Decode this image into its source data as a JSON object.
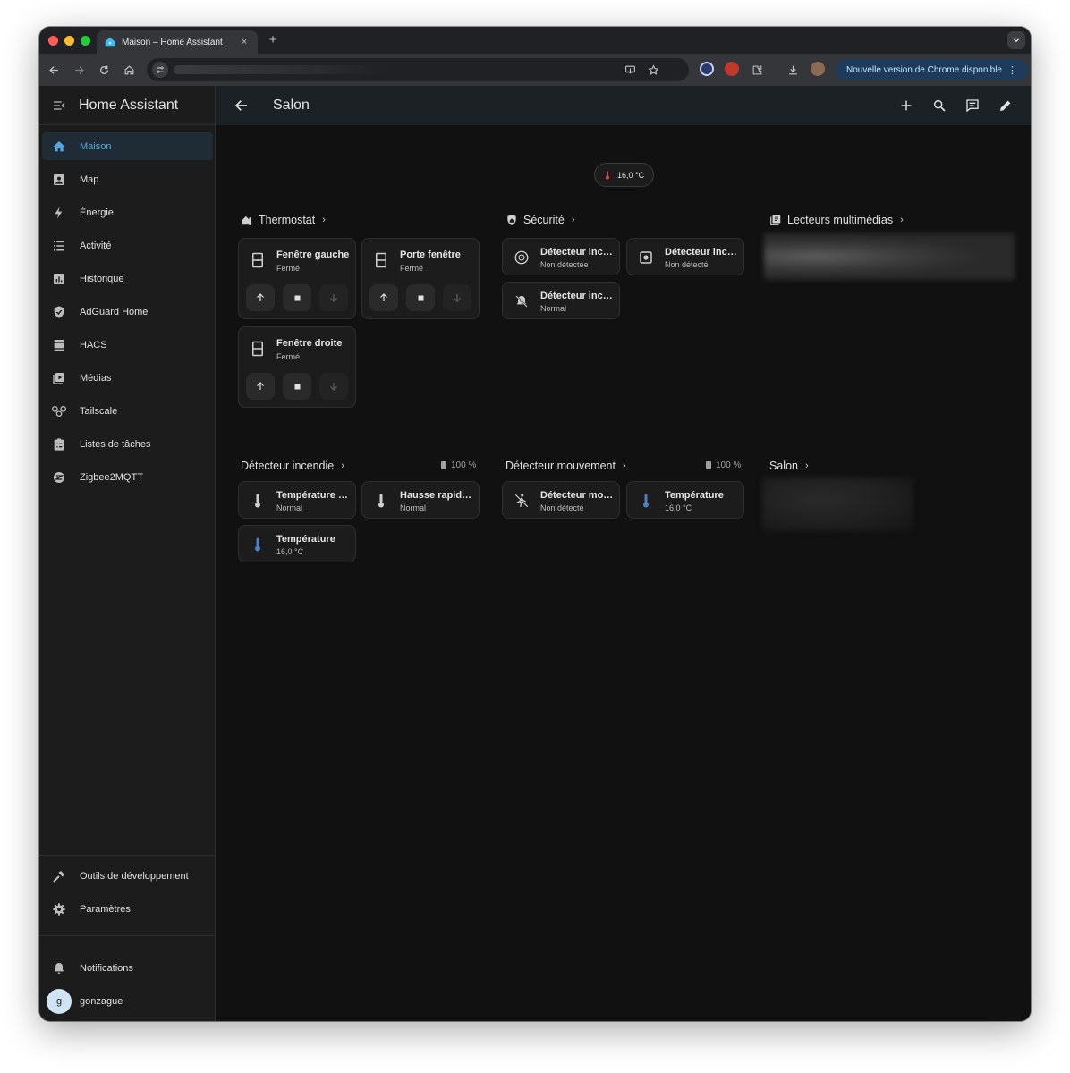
{
  "browser": {
    "tab_title": "Maison – Home Assistant",
    "new_tab": "+",
    "close": "×",
    "update_label": "Nouvelle version de Chrome disponible",
    "more": "⋮"
  },
  "app": {
    "title": "Home Assistant",
    "page_title": "Salon"
  },
  "sidebar": {
    "items": [
      {
        "label": "Maison",
        "icon": "home-icon",
        "active": true
      },
      {
        "label": "Map",
        "icon": "map-icon"
      },
      {
        "label": "Énergie",
        "icon": "lightning-icon"
      },
      {
        "label": "Activité",
        "icon": "list-icon"
      },
      {
        "label": "Historique",
        "icon": "chart-box-icon"
      },
      {
        "label": "AdGuard Home",
        "icon": "shield-check-icon"
      },
      {
        "label": "HACS",
        "icon": "hacs-icon"
      },
      {
        "label": "Médias",
        "icon": "play-box-icon"
      },
      {
        "label": "Tailscale",
        "icon": "tailscale-icon"
      },
      {
        "label": "Listes de tâches",
        "icon": "clipboard-list-icon"
      },
      {
        "label": "Zigbee2MQTT",
        "icon": "zigbee-icon"
      }
    ],
    "bottom": [
      {
        "label": "Outils de développement",
        "icon": "hammer-icon"
      },
      {
        "label": "Paramètres",
        "icon": "gear-icon"
      }
    ],
    "notifications": "Notifications",
    "user": {
      "name": "gonzague",
      "initial": "g"
    }
  },
  "badge": {
    "temperature": "16,0 °C"
  },
  "sections": {
    "thermostat": {
      "title": "Thermostat",
      "cards": [
        {
          "name": "Fenêtre gauche",
          "state": "Fermé"
        },
        {
          "name": "Porte fenêtre",
          "state": "Fermé"
        },
        {
          "name": "Fenêtre droite",
          "state": "Fermé"
        }
      ]
    },
    "securite": {
      "title": "Sécurité",
      "cards": [
        {
          "name": "Détecteur incendie",
          "state": "Non détectée"
        },
        {
          "name": "Détecteur incendie",
          "state": "Non détecté"
        },
        {
          "name": "Détecteur incendie",
          "state": "Normal"
        }
      ]
    },
    "lecteurs": {
      "title": "Lecteurs multimédias"
    },
    "detecteur_incendie": {
      "title": "Détecteur incendie",
      "battery": "100 %",
      "cards": [
        {
          "name": "Température élevée",
          "state": "Normal"
        },
        {
          "name": "Hausse rapide de température",
          "state": "Normal"
        },
        {
          "name": "Température",
          "state": "16,0 °C"
        }
      ]
    },
    "detecteur_mouvement": {
      "title": "Détecteur mouvement",
      "battery": "100 %",
      "cards": [
        {
          "name": "Détecteur mouvement",
          "state": "Non détecté"
        },
        {
          "name": "Température",
          "state": "16,0 °C"
        }
      ]
    },
    "salon": {
      "title": "Salon"
    }
  },
  "colors": {
    "accent": "#54a8e0",
    "temperature_hot": "#e0473d",
    "temperature_cool": "#4a7fc1",
    "chrome_update": "#1f3b5c"
  }
}
